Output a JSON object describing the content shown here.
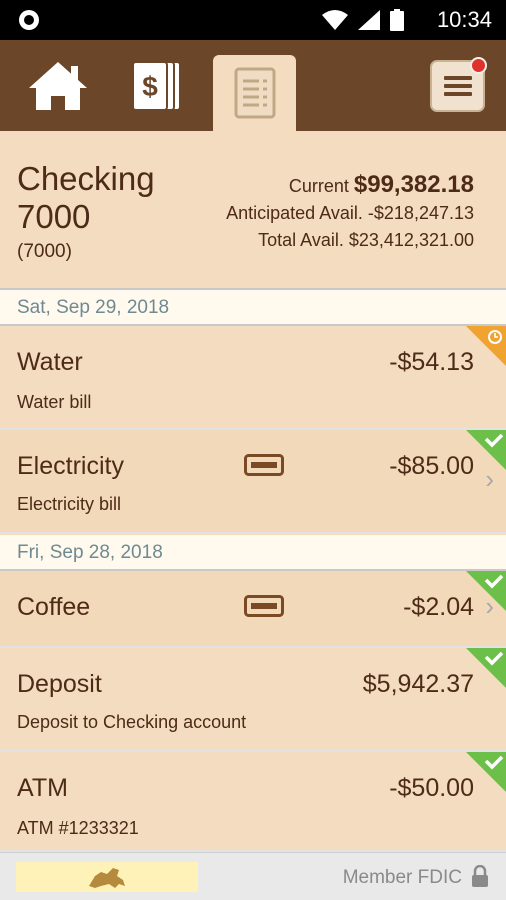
{
  "status_bar": {
    "time": "10:34"
  },
  "nav": {
    "home_icon": "house-icon",
    "accounts_icon": "dollar-cards-icon",
    "statement_icon": "document-list-icon",
    "menu_icon": "hamburger-menu-icon",
    "menu_has_notification": true
  },
  "account": {
    "name": "Checking 7000",
    "number": "(7000)",
    "current_label": "Current",
    "current_value": "$99,382.18",
    "anticipated_label": "Anticipated Avail.",
    "anticipated_value": "-$218,247.13",
    "total_label": "Total Avail.",
    "total_value": "$23,412,321.00"
  },
  "groups": [
    {
      "date": "Sat, Sep 29, 2018",
      "transactions": [
        {
          "name": "Water",
          "memo": "Water bill",
          "amount": "-$54.13",
          "status": "pending"
        },
        {
          "name": "Electricity",
          "memo": "Electricity bill",
          "amount": "-$85.00",
          "status": "cleared",
          "has_card": true
        }
      ]
    },
    {
      "date": "Fri, Sep 28, 2018",
      "transactions": [
        {
          "name": "Coffee",
          "memo": "",
          "amount": "-$2.04",
          "status": "cleared",
          "has_card": true
        },
        {
          "name": "Deposit",
          "memo": "Deposit to Checking account",
          "amount": "$5,942.37",
          "status": "cleared"
        },
        {
          "name": "ATM",
          "memo": "ATM #1233321",
          "amount": "-$50.00",
          "status": "cleared"
        }
      ]
    }
  ],
  "footer": {
    "member_text": "Member FDIC"
  },
  "colors": {
    "nav_bg": "#6b4628",
    "content_bg": "#f3dcc0",
    "text": "#4d2b17",
    "cleared": "#6cc04a",
    "pending": "#f0a330"
  }
}
